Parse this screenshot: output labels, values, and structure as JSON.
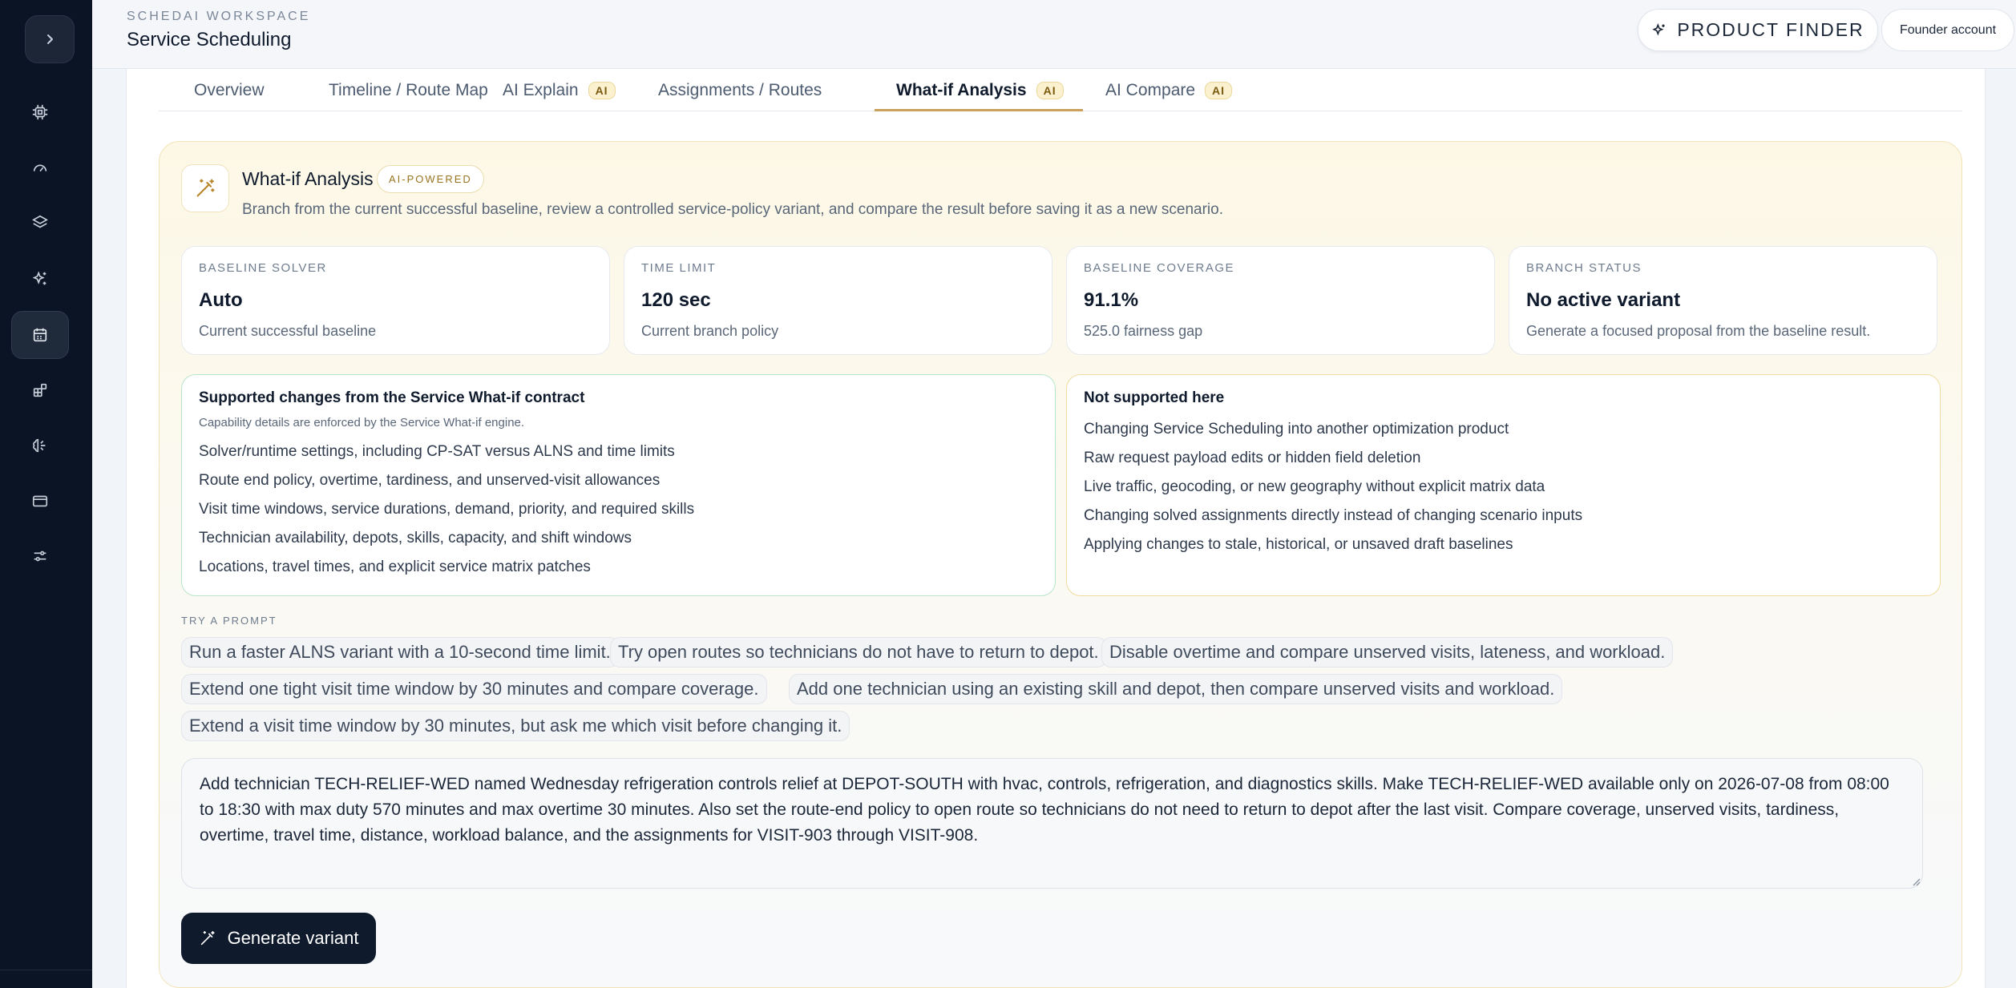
{
  "header": {
    "workspace": "SCHEDAI WORKSPACE",
    "title": "Service Scheduling",
    "product_finder": "PRODUCT FINDER",
    "account": "Founder account"
  },
  "sidebar": {
    "items": [
      {
        "icon": "chip-icon"
      },
      {
        "icon": "gauge-icon"
      },
      {
        "icon": "layers-icon"
      },
      {
        "icon": "sparkles-icon"
      },
      {
        "icon": "calendar-icon",
        "active": true
      },
      {
        "icon": "blocks-icon"
      },
      {
        "icon": "brain-icon"
      },
      {
        "icon": "card-icon"
      },
      {
        "icon": "sliders-icon"
      }
    ]
  },
  "tabs": [
    {
      "label": "Overview"
    },
    {
      "label": "Timeline / Route Map"
    },
    {
      "label": "AI Explain",
      "badge": "AI"
    },
    {
      "label": "Assignments / Routes"
    },
    {
      "label": "What-if Analysis",
      "badge": "AI",
      "active": true
    },
    {
      "label": "AI Compare",
      "badge": "AI"
    }
  ],
  "panel": {
    "title": "What-if Analysis",
    "badge": "AI-POWERED",
    "description": "Branch from the current successful baseline, review a controlled service-policy variant, and compare the result before saving it as a new scenario."
  },
  "stats": [
    {
      "label": "BASELINE SOLVER",
      "value": "Auto",
      "sub": "Current successful baseline"
    },
    {
      "label": "TIME LIMIT",
      "value": "120 sec",
      "sub": "Current branch policy"
    },
    {
      "label": "BASELINE COVERAGE",
      "value": "91.1%",
      "sub": "525.0 fairness gap"
    },
    {
      "label": "BRANCH STATUS",
      "value": "No active variant",
      "sub": "Generate a focused proposal from the baseline result."
    }
  ],
  "supported": {
    "title": "Supported changes from the Service What-if contract",
    "note": "Capability details are enforced by the Service What-if engine.",
    "items": [
      "Solver/runtime settings, including CP-SAT versus ALNS and time limits",
      "Route end policy, overtime, tardiness, and unserved-visit allowances",
      "Visit time windows, service durations, demand, priority, and required skills",
      "Technician availability, depots, skills, capacity, and shift windows",
      "Locations, travel times, and explicit service matrix patches"
    ]
  },
  "unsupported": {
    "title": "Not supported here",
    "items": [
      "Changing Service Scheduling into another optimization product",
      "Raw request payload edits or hidden field deletion",
      "Live traffic, geocoding, or new geography without explicit matrix data",
      "Changing solved assignments directly instead of changing scenario inputs",
      "Applying changes to stale, historical, or unsaved draft baselines"
    ]
  },
  "prompts": {
    "label": "TRY A PROMPT",
    "chips": [
      "Run a faster ALNS variant with a 10-second time limit.",
      "Try open routes so technicians do not have to return to depot.",
      "Disable overtime and compare unserved visits, lateness, and workload.",
      "Extend one tight visit time window by 30 minutes and compare coverage.",
      "Add one technician using an existing skill and depot, then compare unserved visits and workload.",
      "Extend a visit time window by 30 minutes, but ask me which visit before changing it."
    ]
  },
  "prompt_input": {
    "value": "Add technician TECH-RELIEF-WED named Wednesday refrigeration controls relief at DEPOT-SOUTH with hvac, controls, refrigeration, and diagnostics skills. Make TECH-RELIEF-WED available only on 2026-07-08 from 08:00 to 18:30 with max duty 570 minutes and max overtime 30 minutes. Also set the route-end policy to open route so technicians do not need to return to depot after the last visit. Compare coverage, unserved visits, tardiness, overtime, travel time, distance, workload balance, and the assignments for VISIT-903 through VISIT-908."
  },
  "generate_button": "Generate variant"
}
